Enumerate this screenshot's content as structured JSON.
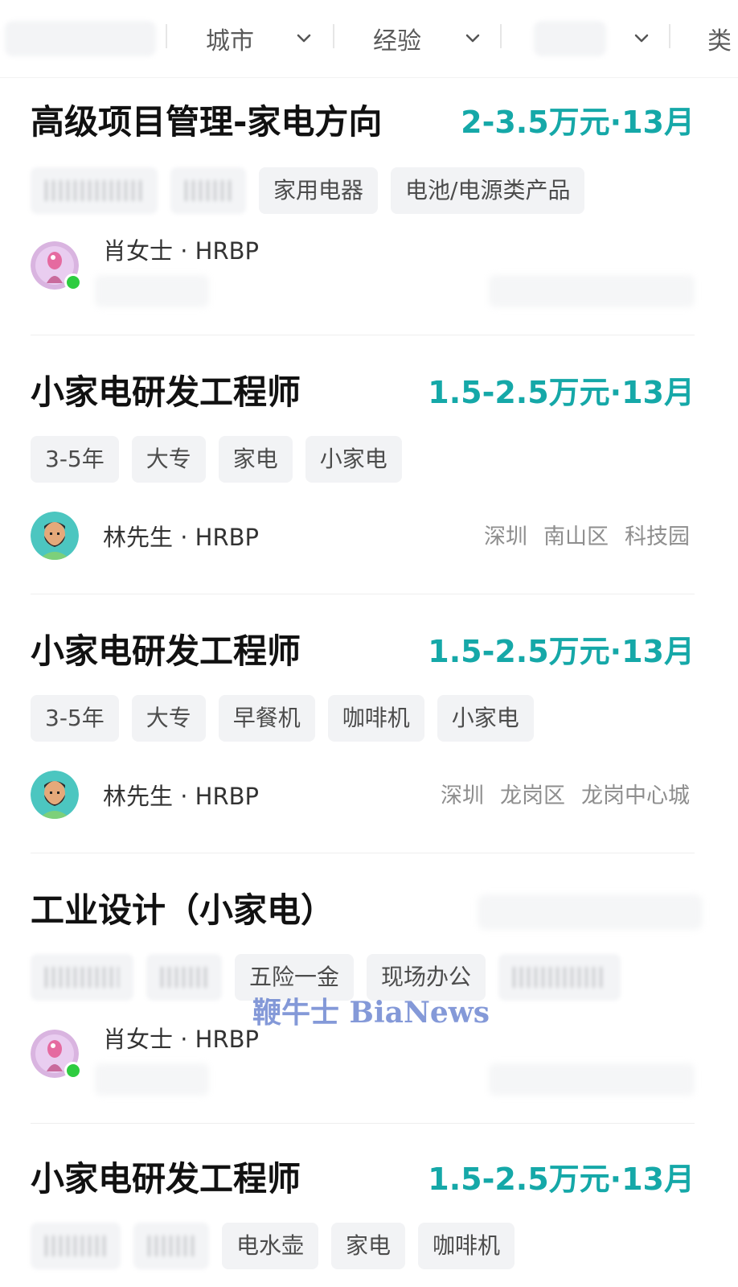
{
  "filters": {
    "city": "城市",
    "experience": "经验",
    "cutoff": "类"
  },
  "jobs": [
    {
      "title": "高级项目管理-家电方向",
      "salary": "2-3.5万元·13月",
      "tags": [
        "家用电器",
        "电池/电源类产品"
      ],
      "recruiter": {
        "name": "肖女士 · HRBP",
        "avatar": "female-avatar",
        "online": true
      }
    },
    {
      "title": "小家电研发工程师",
      "salary": "1.5-2.5万元·13月",
      "tags": [
        "3-5年",
        "大专",
        "家电",
        "小家电"
      ],
      "recruiter": {
        "name": "林先生 · HRBP",
        "avatar": "bearded-man-avatar"
      },
      "location": [
        "深圳",
        "南山区",
        "科技园"
      ]
    },
    {
      "title": "小家电研发工程师",
      "salary": "1.5-2.5万元·13月",
      "tags": [
        "3-5年",
        "大专",
        "早餐机",
        "咖啡机",
        "小家电"
      ],
      "recruiter": {
        "name": "林先生 · HRBP",
        "avatar": "bearded-man-avatar"
      },
      "location": [
        "深圳",
        "龙岗区",
        "龙岗中心城"
      ]
    },
    {
      "title": "工业设计（小家电）",
      "tags": [
        "五险一金",
        "现场办公"
      ],
      "recruiter": {
        "name": "肖女士 · HRBP",
        "avatar": "female-avatar",
        "online": true
      }
    },
    {
      "title": "小家电研发工程师",
      "salary": "1.5-2.5万元·13月",
      "tags": [
        "电水壶",
        "家电",
        "咖啡机"
      ]
    }
  ],
  "watermark": "鞭牛士 BiaNews",
  "colors": {
    "salary": "#15a8a8",
    "tag_bg": "#f2f3f5",
    "online": "#2ecc40"
  }
}
